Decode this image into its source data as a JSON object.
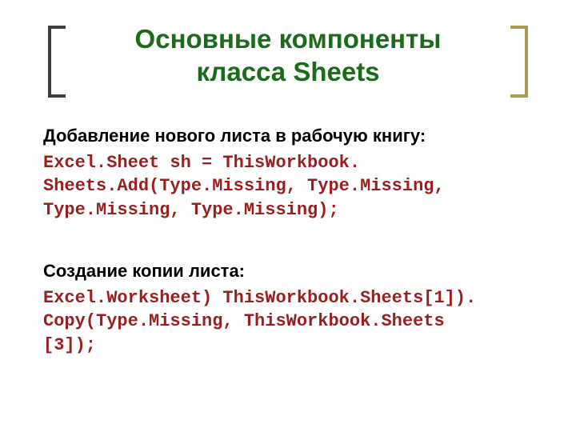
{
  "title_line1": "Основные компоненты",
  "title_line2": "класса Sheets",
  "section1": {
    "label": "Добавление нового листа в рабочую книгу:",
    "code_line1": "Excel.Sheet sh = ThisWorkbook.",
    "code_line2": "Sheets.Add(Type.Missing, Type.Missing,",
    "code_line3": "Type.Missing, Type.Missing);"
  },
  "section2": {
    "label": "Создание копии листа:",
    "code_line1": "Excel.Worksheet) ThisWorkbook.Sheets[1]).",
    "code_line2": "Copy(Type.Missing, ThisWorkbook.Sheets",
    "code_line3": "[3]);"
  }
}
